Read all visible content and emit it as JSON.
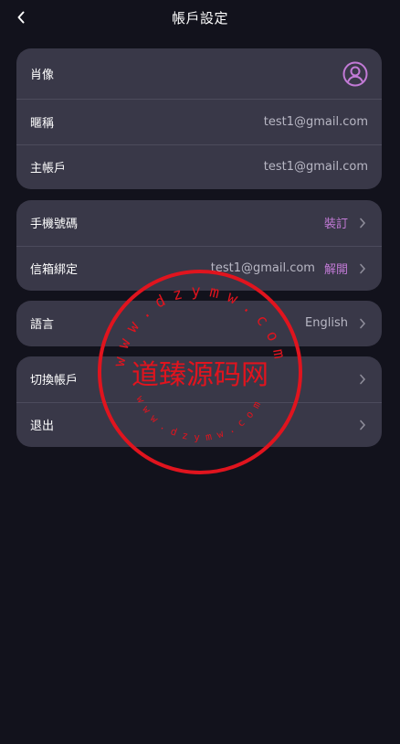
{
  "header": {
    "title": "帳戶設定"
  },
  "profile_card": {
    "avatar_label": "肖像",
    "nickname_label": "暱稱",
    "nickname_value": "test1@gmail.com",
    "main_account_label": "主帳戶",
    "main_account_value": "test1@gmail.com"
  },
  "binding_card": {
    "phone_label": "手機號碼",
    "phone_action": "裝訂",
    "email_label": "信箱綁定",
    "email_value": "test1@gmail.com",
    "email_action": "解開"
  },
  "language_card": {
    "label": "語言",
    "value": "English"
  },
  "account_card": {
    "switch_label": "切換帳戶",
    "logout_label": "退出"
  },
  "watermark": {
    "center_text": "道臻源码网",
    "ring_top": "www.dzymw.com",
    "ring_bottom": "www.dzymw.com"
  },
  "colors": {
    "background": "#12121c",
    "card": "#393848",
    "accent": "#c27ad6",
    "stamp": "#e0141e"
  }
}
